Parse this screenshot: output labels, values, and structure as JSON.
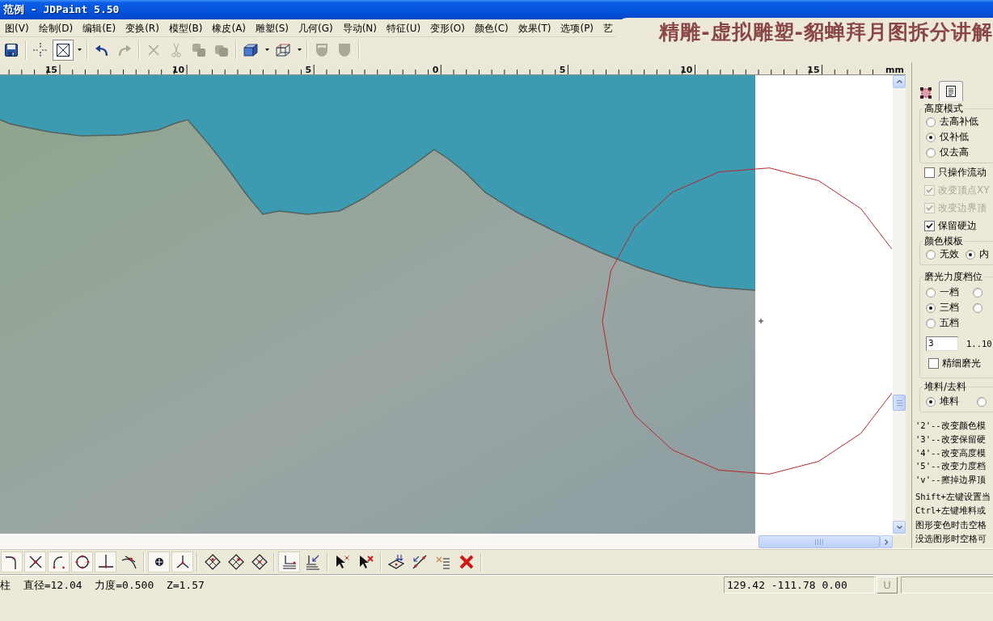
{
  "title_bar": {
    "title": "范例 - JDPaint 5.50"
  },
  "caption_banner": {
    "text": "精雕-虚拟雕塑-貂蝉拜月图拆分讲解"
  },
  "menu_bar": [
    "图(V)",
    "绘制(D)",
    "编辑(E)",
    "变换(R)",
    "模型(B)",
    "橡皮(A)",
    "雕塑(S)",
    "几何(G)",
    "导动(N)",
    "特征(U)",
    "变形(O)",
    "颜色(C)",
    "效果(T)",
    "选项(P)",
    "艺"
  ],
  "toolbar": [
    {
      "pressed": false,
      "disabled": false
    },
    {
      "pressed": false,
      "disabled": false
    },
    {
      "pressed": true,
      "disabled": false
    },
    {
      "pressed": false,
      "disabled": false
    },
    {
      "pressed": false,
      "disabled": true
    },
    {
      "pressed": false,
      "disabled": true
    },
    {
      "pressed": false,
      "disabled": true
    },
    {
      "pressed": false,
      "disabled": true
    },
    {
      "pressed": false,
      "disabled": true
    },
    {
      "pressed": false,
      "disabled": false
    },
    {
      "pressed": false,
      "disabled": false
    },
    {
      "pressed": false,
      "disabled": true
    },
    {
      "pressed": false,
      "disabled": true
    }
  ],
  "ruler": {
    "labels": [
      "15",
      "10",
      "5",
      "0",
      "5",
      "10",
      "15"
    ],
    "unit": "mm"
  },
  "side_panel": {
    "tabs": [
      {
        "selected": false
      },
      {
        "selected": true
      }
    ],
    "height_mode": {
      "title": "高度模式",
      "options": [
        {
          "label": "去高补低",
          "selected": false
        },
        {
          "label": "仅补低",
          "selected": true
        },
        {
          "label": "仅去高",
          "selected": false
        }
      ]
    },
    "checkboxes": [
      {
        "label": "只操作流动",
        "checked": false,
        "disabled": false
      },
      {
        "label": "改变顶点XY",
        "checked": true,
        "disabled": true
      },
      {
        "label": "改变边界顶",
        "checked": true,
        "disabled": true
      },
      {
        "label": "保留硬边",
        "checked": true,
        "disabled": false
      }
    ],
    "color_template": {
      "title": "颜色模板",
      "options": [
        {
          "label": "无效",
          "selected": false
        },
        {
          "label": "内",
          "selected": true
        }
      ]
    },
    "polish_level": {
      "title": "磨光力度档位",
      "options": [
        {
          "label": "一档",
          "selected": false
        },
        {
          "selected": false
        },
        {
          "label": "三档",
          "selected": true
        },
        {
          "selected": false
        },
        {
          "label": "五档",
          "selected": false
        }
      ],
      "value": "3",
      "range": "1..10",
      "fine_polish": {
        "label": "精细磨光",
        "checked": false
      }
    },
    "material": {
      "title": "堆料/去料",
      "options": [
        {
          "label": "堆料",
          "selected": true
        },
        {
          "selected": false
        }
      ]
    },
    "hints": [
      "'2'--改变颜色模",
      "'3'--改变保留硬",
      "'4'--改变高度模",
      "'5'--改变力度档",
      "'v'--擦掉边界顶"
    ],
    "tips": [
      "Shift+左键设置当",
      "Ctrl+左键堆料或",
      "图形变色时击空格",
      "没选图形时空格可"
    ]
  },
  "bottom_toolbar": [
    {
      "pressed": true
    },
    {
      "pressed": true
    },
    {
      "pressed": true
    },
    {
      "pressed": true
    },
    {
      "pressed": true
    },
    {
      "pressed": false
    },
    {
      "pressed": true
    },
    {
      "pressed": true
    },
    {
      "pressed": false
    },
    {
      "pressed": false
    },
    {
      "pressed": false
    },
    {
      "pressed": true
    },
    {
      "pressed": false
    },
    {
      "pressed": false
    },
    {
      "pressed": false
    },
    {
      "pressed": false
    },
    {
      "pressed": false
    },
    {
      "pressed": false
    },
    {
      "pressed": false
    }
  ],
  "status_bar": {
    "message": "柱  直径=12.04  力度=0.500  Z=1.57",
    "coordinates": "129.42 -111.78 0.00",
    "button": "U"
  }
}
